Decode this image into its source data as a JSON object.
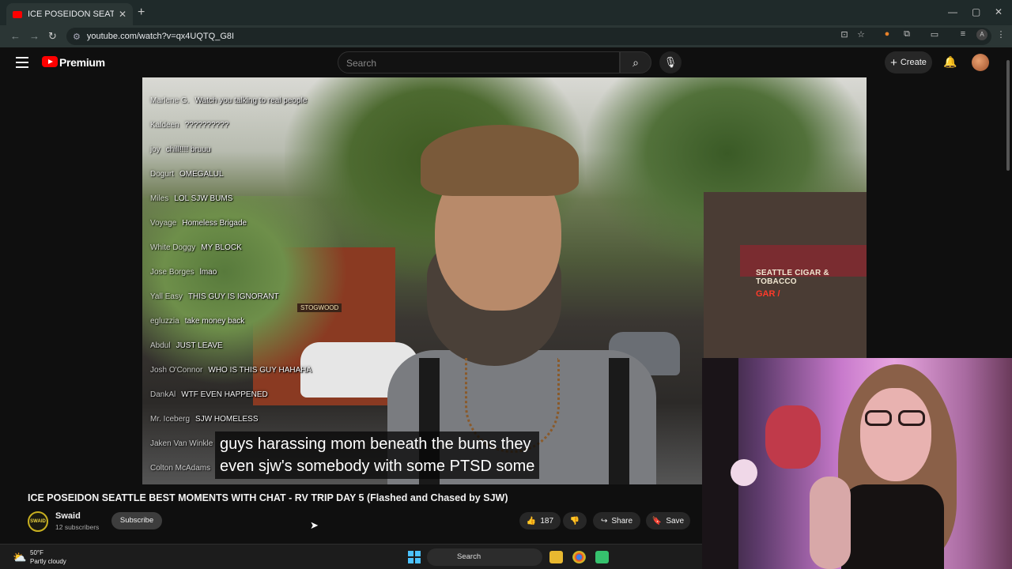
{
  "browser": {
    "tab_title": "ICE POSEIDON SEATTLE BEST M",
    "tab_close": "✕",
    "new_tab": "+",
    "url": "youtube.com/watch?v=qx4UQTQ_G8I",
    "window_controls": {
      "minimize": "—",
      "maximize": "▢",
      "close": "✕"
    },
    "nav": {
      "back": "←",
      "forward": "→",
      "reload": "↻"
    }
  },
  "youtube": {
    "brand": "Premium",
    "search_placeholder": "Search",
    "create_label": "Create",
    "create_icon": "+",
    "icons": {
      "search": "⌕",
      "mic": "🎙",
      "bell": "🔔"
    }
  },
  "video": {
    "chat": [
      {
        "user": "Marlene G.",
        "msg": "Watch you talking to real people"
      },
      {
        "user": "Kaldeen",
        "msg": "??????????"
      },
      {
        "user": "joy",
        "msg": "chill!!!! bruuu"
      },
      {
        "user": "Dogurt",
        "msg": "OMEGALUL"
      },
      {
        "user": "Miles",
        "msg": "LOL SJW BUMS"
      },
      {
        "user": "Voyage",
        "msg": "Homeless Brigade"
      },
      {
        "user": "White Doggy",
        "msg": "MY BLOCK"
      },
      {
        "user": "Jose Borges",
        "msg": "lmao"
      },
      {
        "user": "Yall Easy",
        "msg": "THIS GUY IS IGNORANT"
      },
      {
        "user": "egluzzia",
        "msg": "take money back"
      },
      {
        "user": "Abdul",
        "msg": "JUST LEAVE"
      },
      {
        "user": "Josh O'Connor",
        "msg": "WHO IS THIS GUY HAHAHA"
      },
      {
        "user": "DankAl",
        "msg": "WTF EVEN HAPPENED"
      },
      {
        "user": "Mr. Iceberg",
        "msg": "SJW HOMELESS"
      },
      {
        "user": "Jaken Van Winkle",
        "msg": ""
      },
      {
        "user": "Colton McAdams",
        "msg": ""
      }
    ],
    "caption_line1": "guys harassing mom beneath the bums they",
    "caption_line2": "even sjw's somebody with some PTSD some",
    "scene_signs": {
      "cigar_shop": "SEATTLE CIGAR & TOBACCO",
      "neon": "GAR /",
      "store": "STOGWOOD"
    }
  },
  "below_video": {
    "title": "ICE POSEIDON SEATTLE BEST MOMENTS WITH CHAT - RV TRIP DAY 5 (Flashed and Chased by SJW)",
    "channel_logo_text": "SWAID",
    "channel_name": "Swaid",
    "subscribers": "12 subscribers",
    "subscribe_label": "Subscribe",
    "like_count": "187",
    "share_label": "Share",
    "save_label": "Save",
    "icons": {
      "like": "👍",
      "dislike": "👎",
      "share": "↪",
      "save": "🔖"
    }
  },
  "taskbar": {
    "temperature": "50°F",
    "weather": "Partly cloudy",
    "search_label": "Search"
  },
  "colors": {
    "yt_red": "#ff0000",
    "bg": "#0f0f0f",
    "accent_blue": "#4cc2ff"
  }
}
